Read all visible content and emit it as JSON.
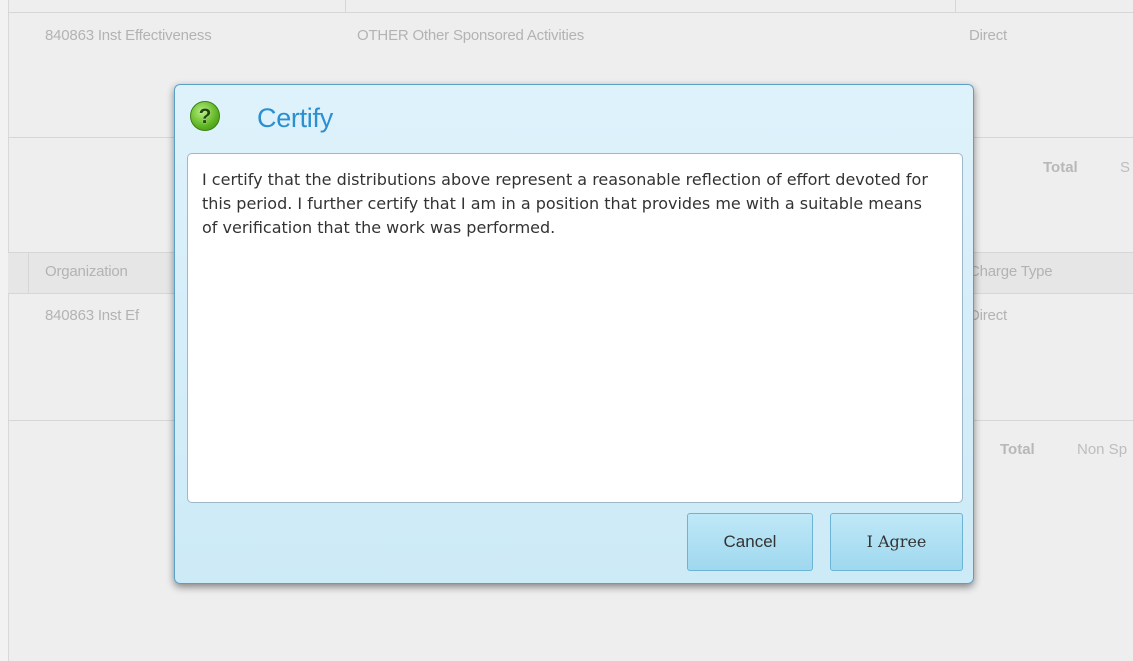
{
  "background": {
    "rows_top": [
      {
        "organization": "840863 Inst Effectiveness",
        "fund": "OTHER Other Sponsored Activities",
        "charge_type": "Direct"
      }
    ],
    "total_top": {
      "label": "Total",
      "value": "S"
    },
    "table2_headers": {
      "organization": "Organization",
      "charge_type": "Charge Type"
    },
    "rows_bottom": [
      {
        "organization": "840863 Inst Ef",
        "charge_type": "Direct"
      }
    ],
    "total_bottom": {
      "label": "Total",
      "value": "Non Sp"
    }
  },
  "dialog": {
    "icon": "question-icon",
    "icon_glyph": "?",
    "title": "Certify",
    "message": "I certify that the distributions above represent a reasonable reflection of effort devoted for this period. I further certify that I am in a position that provides me with a suitable means of verification that the work was performed.",
    "buttons": {
      "cancel": "Cancel",
      "agree": "I Agree"
    }
  },
  "colors": {
    "dialog_bg": "#d6eef9",
    "title": "#2b8fd1",
    "button_bg": "#aedff3",
    "icon_green": "#5db422"
  }
}
